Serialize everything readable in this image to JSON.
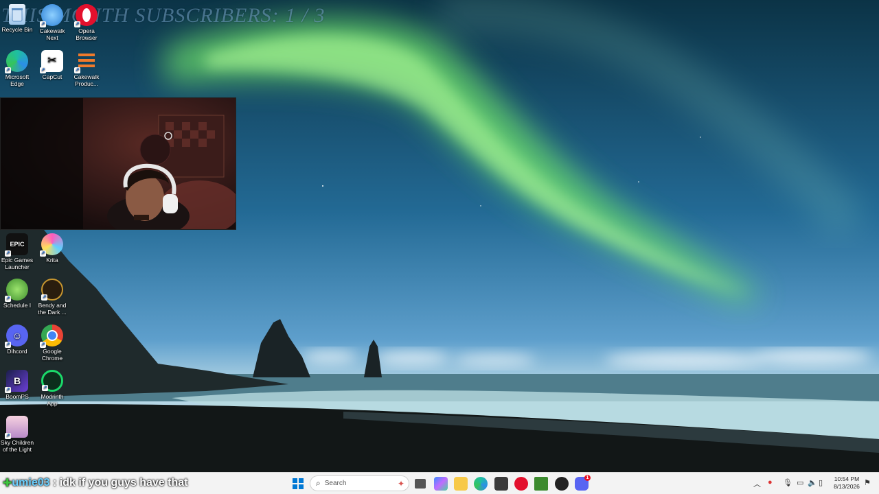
{
  "overlay": {
    "title": "THIS MONTH SUBSCRIBERS: 1 / 3"
  },
  "desktop_icons": [
    {
      "label": "Recycle Bin",
      "icon": "recycle-bin-icon"
    },
    {
      "label": "Cakewalk Next",
      "icon": "cakewalk-next-icon"
    },
    {
      "label": "Opera Browser",
      "icon": "opera-icon"
    },
    {
      "label": "Microsoft Edge",
      "icon": "edge-icon"
    },
    {
      "label": "CapCut",
      "icon": "capcut-icon"
    },
    {
      "label": "Cakewalk Produc...",
      "icon": "cakewalk-icon"
    },
    {
      "label": "Epic Games Launcher",
      "icon": "epic-games-icon"
    },
    {
      "label": "Krita",
      "icon": "krita-icon"
    },
    {
      "label": "Schedule I",
      "icon": "schedule-icon"
    },
    {
      "label": "Bendy and the Dark ...",
      "icon": "bendy-icon"
    },
    {
      "label": "Dihcord",
      "icon": "discord-icon"
    },
    {
      "label": "Google Chrome",
      "icon": "chrome-icon"
    },
    {
      "label": "BoomPS",
      "icon": "boomps-icon"
    },
    {
      "label": "Modrinth App",
      "icon": "modrinth-icon"
    },
    {
      "label": "Sky Children of the Light",
      "icon": "sky-icon"
    }
  ],
  "chat": {
    "username": "umie03",
    "separator": " : ",
    "message": "idk if you guys have that"
  },
  "taskbar": {
    "search_placeholder": "Search",
    "pinned": [
      "windows-start-icon",
      "task-view-icon",
      "copilot-icon",
      "file-explorer-icon",
      "edge-icon",
      "microsoft-store-icon",
      "opera-icon",
      "minecraft-icon",
      "steam-icon",
      "discord-icon"
    ],
    "discord_badge": "1",
    "clock": {
      "time": "10:54 PM",
      "date": "8/13/2026"
    }
  },
  "colors": {
    "taskbar_bg": "#f3f3f3",
    "chat_user": "#6ad0ff",
    "aurora": "#7df07a"
  }
}
